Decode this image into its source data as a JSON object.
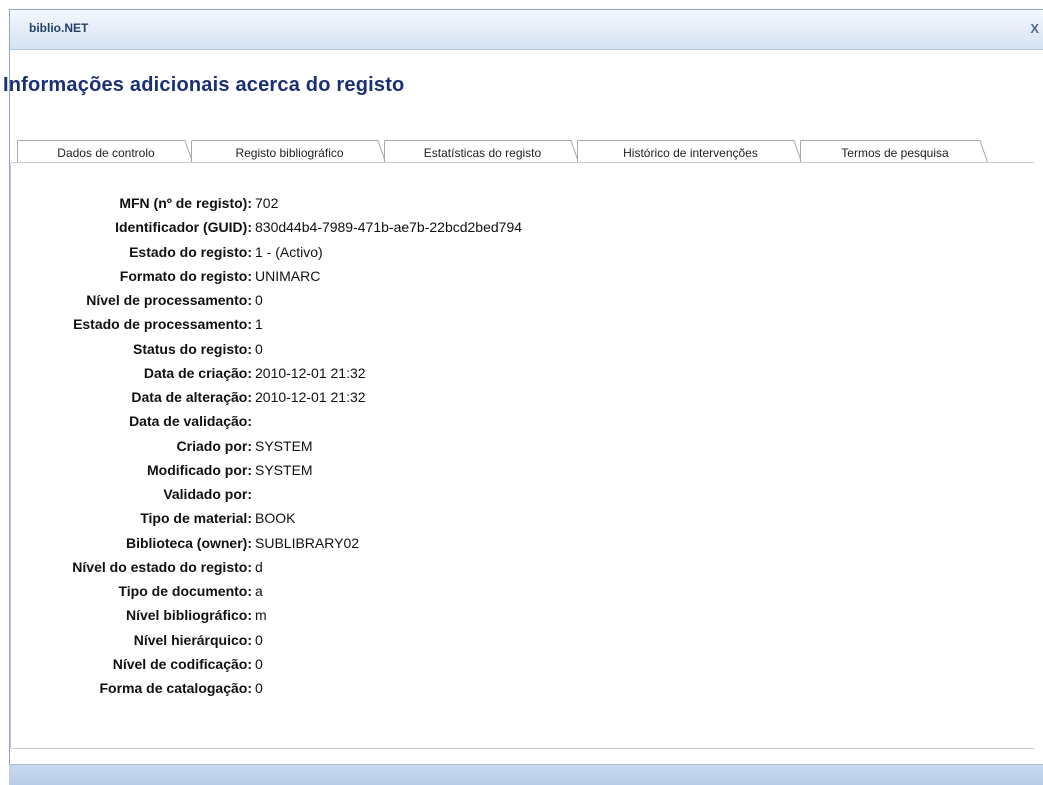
{
  "window": {
    "title": "biblio.NET",
    "close_label": "X"
  },
  "page_title": "Informações adicionais acerca do registo",
  "tabs": [
    {
      "label": "Dados de controlo",
      "active": true
    },
    {
      "label": "Registo bibliográfico",
      "active": false
    },
    {
      "label": "Estatísticas do registo",
      "active": false
    },
    {
      "label": "Histórico de intervenções",
      "active": false
    },
    {
      "label": "Termos de pesquisa",
      "active": false
    }
  ],
  "fields": [
    {
      "label": "MFN (nº de registo):",
      "value": "702"
    },
    {
      "label": "Identificador (GUID):",
      "value": "830d44b4-7989-471b-ae7b-22bcd2bed794"
    },
    {
      "label": "Estado do registo:",
      "value": "1 - (Activo)"
    },
    {
      "label": "Formato do registo:",
      "value": "UNIMARC"
    },
    {
      "label": "Nível de processamento:",
      "value": "0"
    },
    {
      "label": "Estado de processamento:",
      "value": "1"
    },
    {
      "label": "Status do registo:",
      "value": "0"
    },
    {
      "label": "Data de criação:",
      "value": "2010-12-01 21:32"
    },
    {
      "label": "Data de alteração:",
      "value": "2010-12-01 21:32"
    },
    {
      "label": "Data de validação:",
      "value": ""
    },
    {
      "label": "Criado por:",
      "value": "SYSTEM"
    },
    {
      "label": "Modificado por:",
      "value": "SYSTEM"
    },
    {
      "label": "Validado por:",
      "value": ""
    },
    {
      "label": "Tipo de material:",
      "value": "BOOK"
    },
    {
      "label": "Biblioteca (owner):",
      "value": "SUBLIBRARY02"
    },
    {
      "label": "Nível do estado do registo:",
      "value": "d"
    },
    {
      "label": "Tipo de documento:",
      "value": "a"
    },
    {
      "label": "Nível bibliográfico:",
      "value": "m"
    },
    {
      "label": "Nível hierárquico:",
      "value": "0"
    },
    {
      "label": "Nível de codificação:",
      "value": "0"
    },
    {
      "label": "Forma de catalogação:",
      "value": "0"
    }
  ],
  "colors": {
    "title": "#1a2f74",
    "titlebar": "#e3ecf8",
    "tab_active_bg": "#ffffff",
    "tab_inactive_bg": "#ffffff",
    "tab_border": "#a0a0a0"
  }
}
